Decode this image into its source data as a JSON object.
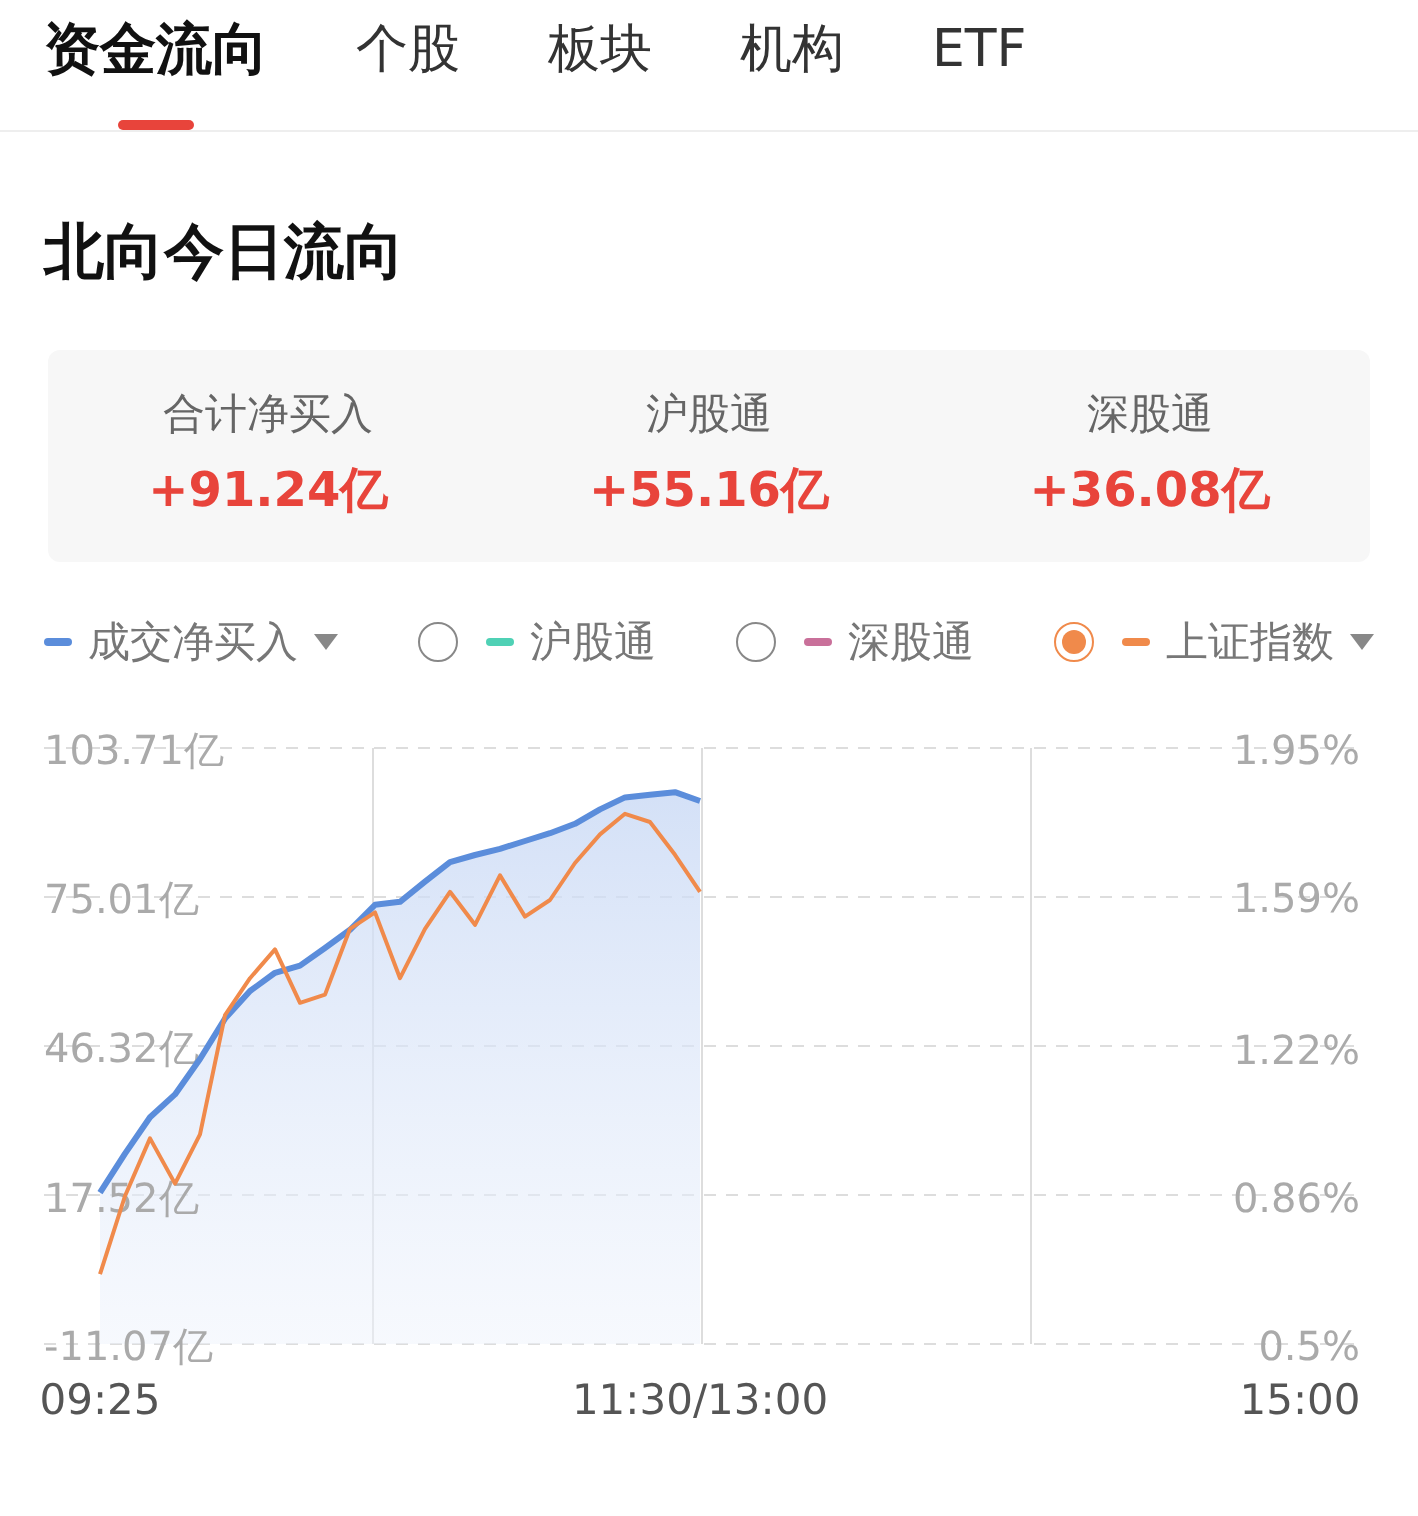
{
  "tabs": [
    {
      "label": "资金流向",
      "selected": true
    },
    {
      "label": "个股",
      "selected": false
    },
    {
      "label": "板块",
      "selected": false
    },
    {
      "label": "机构",
      "selected": false
    },
    {
      "label": "ETF",
      "selected": false
    }
  ],
  "title": "北向今日流向",
  "summary": [
    {
      "label": "合计净买入",
      "value": "+91.24亿"
    },
    {
      "label": "沪股通",
      "value": "+55.16亿"
    },
    {
      "label": "深股通",
      "value": "+36.08亿"
    }
  ],
  "legend": [
    {
      "kind": "series",
      "label": "成交净买入",
      "color": "#5b8ddb",
      "dropdown": true
    },
    {
      "kind": "radio",
      "label": "沪股通",
      "color": "#4fd1b5",
      "selected": false,
      "dropdown": false
    },
    {
      "kind": "radio",
      "label": "深股通",
      "color": "#c9709a",
      "selected": false,
      "dropdown": false
    },
    {
      "kind": "radio",
      "label": "上证指数",
      "color": "#f08a4b",
      "selected": true,
      "dropdown": true
    }
  ],
  "chart_data": {
    "type": "line",
    "grid": true,
    "categories": [
      "09:25",
      null,
      null,
      null,
      null,
      null,
      null,
      null,
      null,
      null,
      null,
      null,
      null,
      null,
      null,
      null,
      null,
      null,
      null,
      null,
      null,
      null,
      null,
      null,
      "11:30/13:00",
      null,
      null,
      null,
      null,
      null,
      null,
      null,
      null,
      null,
      null,
      null,
      null,
      null,
      null,
      null,
      null,
      null,
      null,
      null,
      null,
      null,
      null,
      null,
      "15:00"
    ],
    "ylim": [
      -11.07,
      103.71
    ],
    "yticks": [
      {
        "value": 103.71,
        "label": "103.71亿"
      },
      {
        "value": 75.01,
        "label": "75.01亿"
      },
      {
        "value": 46.32,
        "label": "46.32亿"
      },
      {
        "value": 17.52,
        "label": "17.52亿"
      },
      {
        "value": -11.07,
        "label": "-11.07亿"
      }
    ],
    "y2lim": [
      0.5,
      1.95
    ],
    "y2ticks": [
      {
        "value": 1.95,
        "label": "1.95%"
      },
      {
        "value": 1.59,
        "label": "1.59%"
      },
      {
        "value": 1.22,
        "label": "1.22%"
      },
      {
        "value": 0.86,
        "label": "0.86%"
      },
      {
        "value": 0.5,
        "label": "0.5%"
      }
    ],
    "series": [
      {
        "color": "#5b8ddb",
        "values": [
          18.1,
          25.6,
          32.6,
          37,
          43.8,
          51.6,
          56.9,
          60.4,
          61.8,
          65.2,
          68.7,
          73.5,
          74.1,
          78,
          81.7,
          83.1,
          84.3,
          85.8,
          87.3,
          89.1,
          91.9,
          94.2,
          94.7,
          95.2,
          93.5,
          null,
          null,
          null,
          null,
          null,
          null,
          null,
          null,
          null,
          null,
          null,
          null,
          null,
          null,
          null,
          null,
          null,
          null,
          null,
          null,
          null,
          null,
          null,
          null
        ]
      },
      {
        "color": "#f08a4b",
        "axis": "y2",
        "values": [
          0.67,
          0.86,
          1.0,
          0.89,
          1.01,
          1.3,
          1.39,
          1.46,
          1.33,
          1.35,
          1.51,
          1.55,
          1.39,
          1.51,
          1.6,
          1.52,
          1.64,
          1.54,
          1.58,
          1.67,
          1.74,
          1.79,
          1.77,
          1.69,
          1.6,
          null,
          null,
          null,
          null,
          null,
          null,
          null,
          null,
          null,
          null,
          null,
          null,
          null,
          null,
          null,
          null,
          null,
          null,
          null,
          null,
          null,
          null,
          null,
          null
        ]
      }
    ]
  }
}
